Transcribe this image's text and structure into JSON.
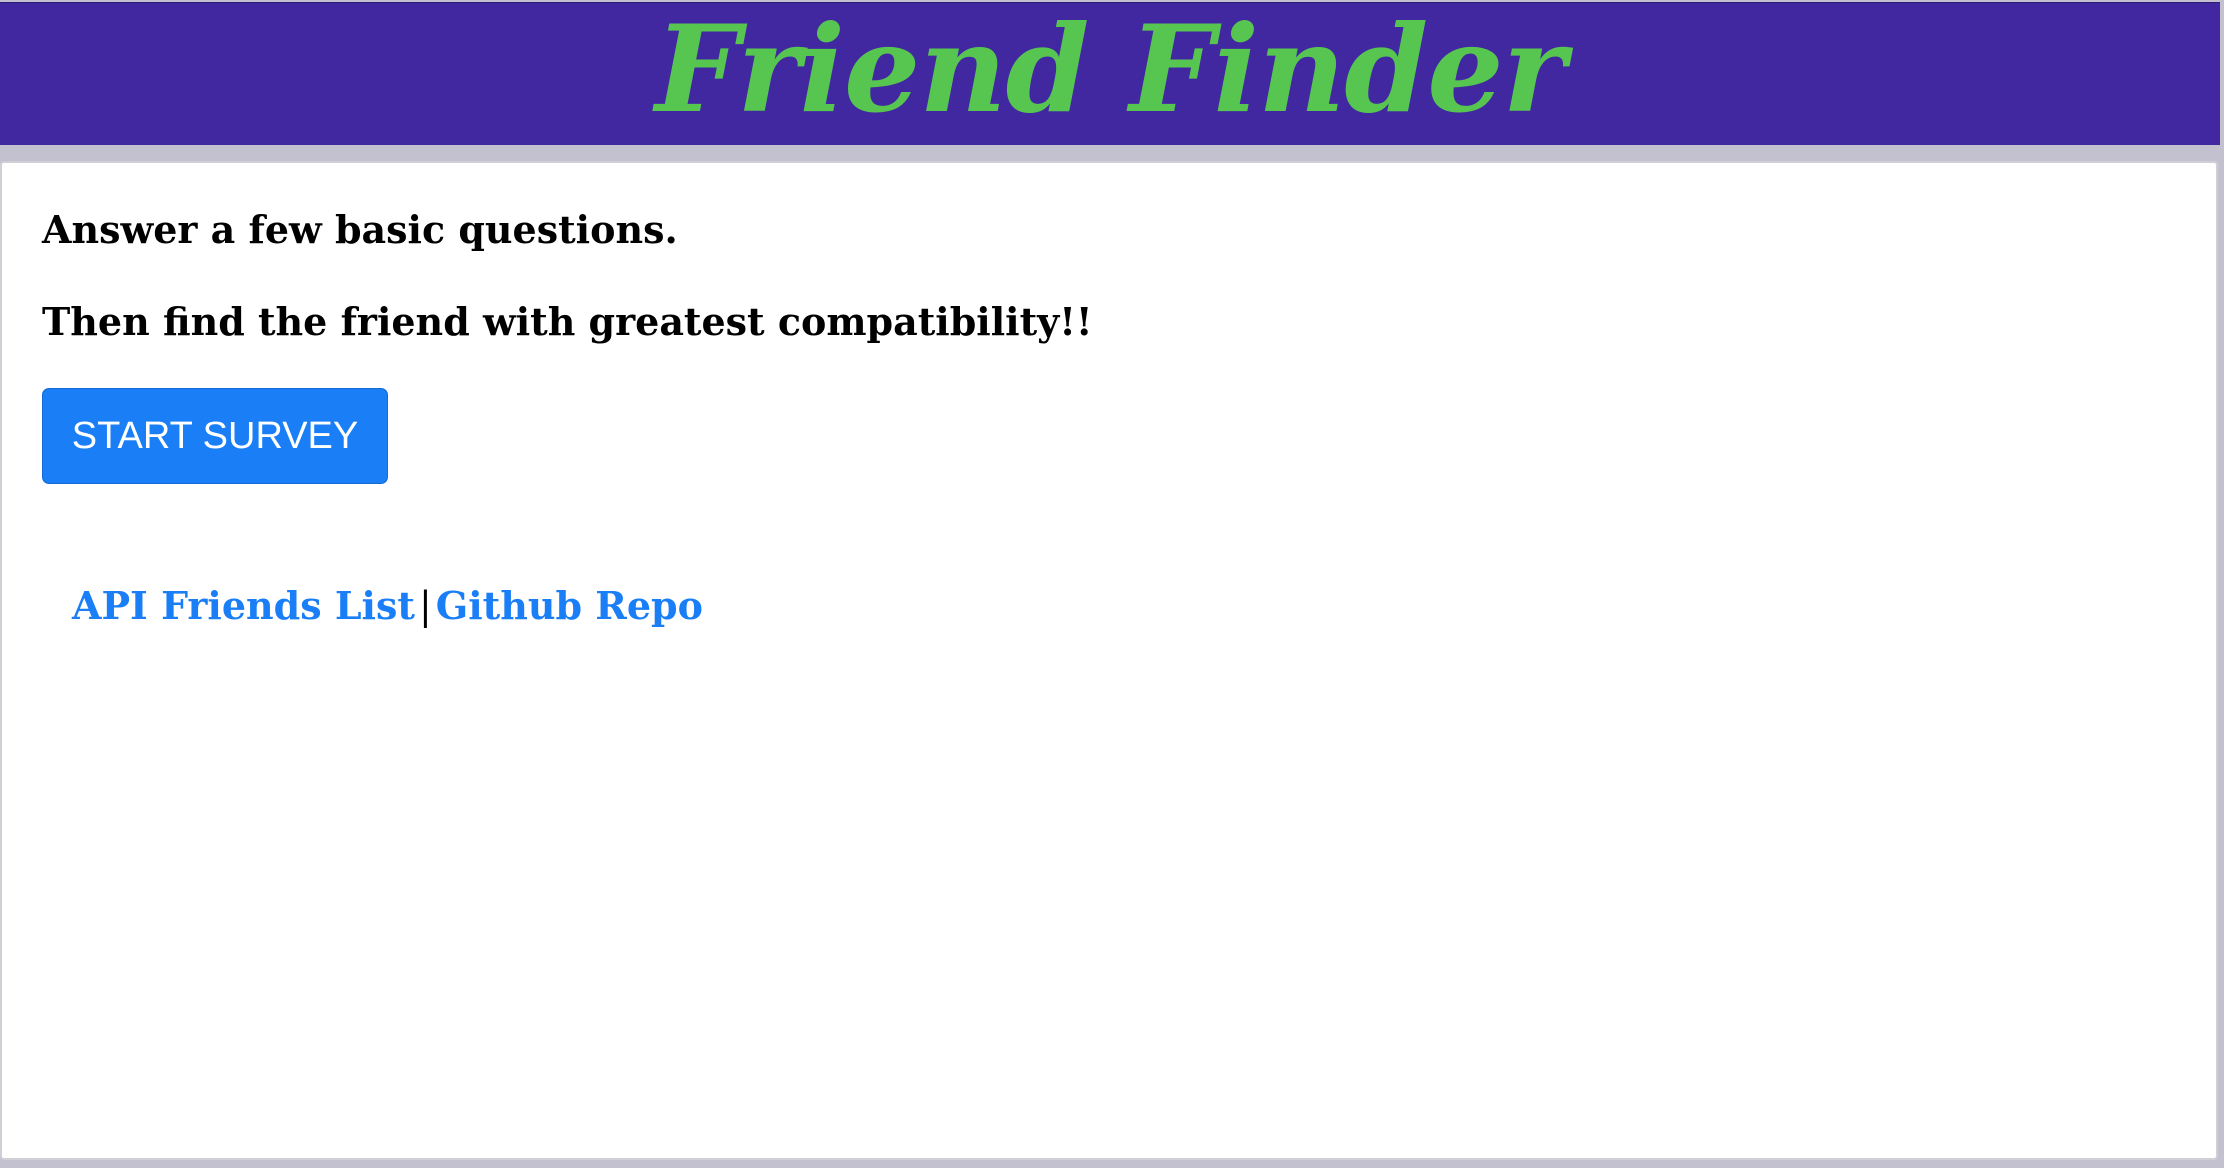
{
  "header": {
    "title": "Friend Finder"
  },
  "main": {
    "line_1": "Answer a few basic questions.",
    "line_2": "Then find the friend with greatest compatibility!!",
    "start_button_label": "START SURVEY"
  },
  "footer_links": {
    "api_link": "API Friends List",
    "separator": "|",
    "github_link": "Github Repo"
  },
  "colors": {
    "header_background": "#4128a1",
    "title_color": "#56c651",
    "button_color": "#1a7ef6",
    "link_color": "#1a7ef6"
  }
}
